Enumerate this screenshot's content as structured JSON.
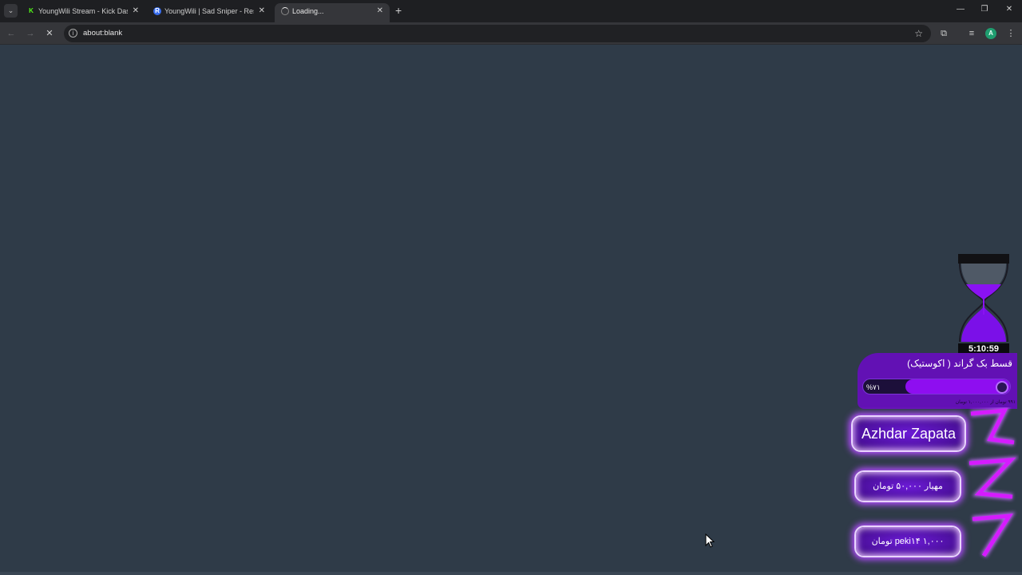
{
  "browser": {
    "tabs": [
      {
        "title": "YoungWili Stream - Kick Dashb",
        "favicon": "kick-icon",
        "active": false
      },
      {
        "title": "YoungWili | Sad Sniper - Restre",
        "favicon": "restream-icon",
        "active": false
      },
      {
        "title": "Loading...",
        "favicon": "loading-spinner-icon",
        "active": true
      }
    ],
    "address": "about:blank",
    "profile_initial": "A"
  },
  "overlay": {
    "timer": "5:10:59",
    "goal": {
      "title": "قسط بک گراند ( اکوستیک)",
      "percent_label": "%۷۱",
      "progress": 0.71,
      "subtitle": "۹۹۱ تومان از ۱,۰۰۰,۰۰۰ تومان"
    },
    "top_donor": "Azhdar Zapata",
    "donations": [
      "مهیار  ۵۰,۰۰۰ تومان",
      "peki۱۴  ۱,۰۰۰ تومان"
    ]
  },
  "colors": {
    "page_bg": "#2f3b48",
    "accent_purple": "#8e0ef0",
    "card_purple": "#6211b4"
  }
}
